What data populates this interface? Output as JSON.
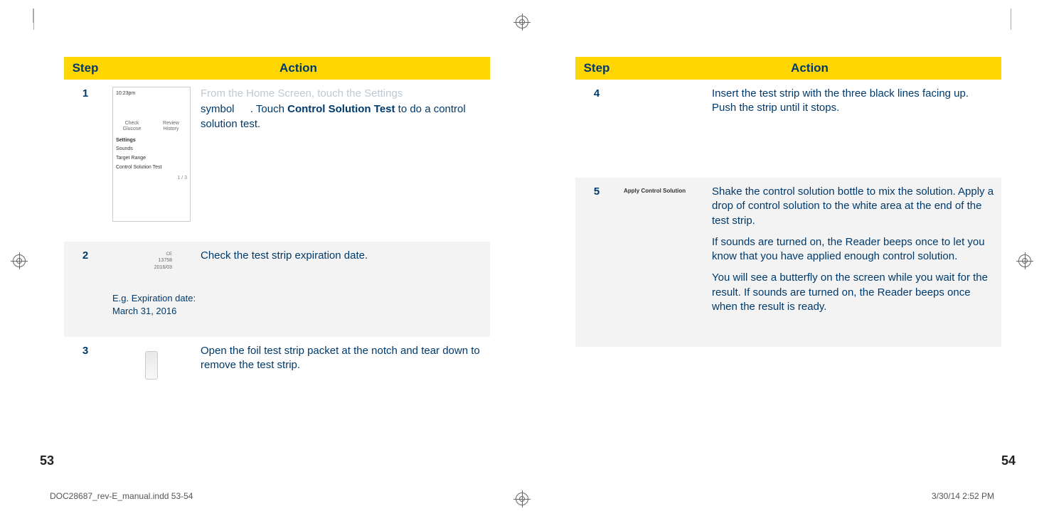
{
  "headers": {
    "step": "Step",
    "action": "Action"
  },
  "left": {
    "page_number": "53",
    "steps": [
      {
        "num": "1",
        "thumb": {
          "time": "10:23pm",
          "icons": [
            "Check Glucose",
            "Review History"
          ],
          "menu": [
            "Settings",
            "Sounds",
            "Target Range",
            "Control Solution Test"
          ],
          "selected": "Settings",
          "pager": "1 / 3"
        },
        "faded_line": "From the Home Screen, touch the Settings",
        "text_parts": [
          "symbol ",
          ". Touch ",
          "Control Solution Test",
          " to do a control solution test."
        ]
      },
      {
        "num": "2",
        "thumb": {
          "ce": "CE",
          "lot": "13758",
          "exp": "2016/03"
        },
        "text": "Check the test strip expiration date.",
        "extra": "E.g. Expiration date:\nMarch 31, 2016"
      },
      {
        "num": "3",
        "text": "Open the foil test strip packet at the notch and tear down to remove the test strip."
      }
    ]
  },
  "right": {
    "page_number": "54",
    "steps": [
      {
        "num": "4",
        "text": "Insert the test strip with the three black lines facing up. Push the strip until it stops."
      },
      {
        "num": "5",
        "thumb_label": "Apply Control Solution",
        "para1": "Shake the control solution bottle to mix the solution. Apply a drop of control solution to the white area at the end of the test strip.",
        "para2": "If sounds are turned on, the Reader beeps once to let you know that you have applied enough control solution.",
        "para3": "You will see a butterfly on the screen while you wait for the result. If sounds are turned on, the Reader beeps once when the result is ready."
      }
    ]
  },
  "footer": {
    "file": "DOC28687_rev-E_manual.indd   53-54",
    "stamp": "3/30/14   2:52 PM"
  }
}
